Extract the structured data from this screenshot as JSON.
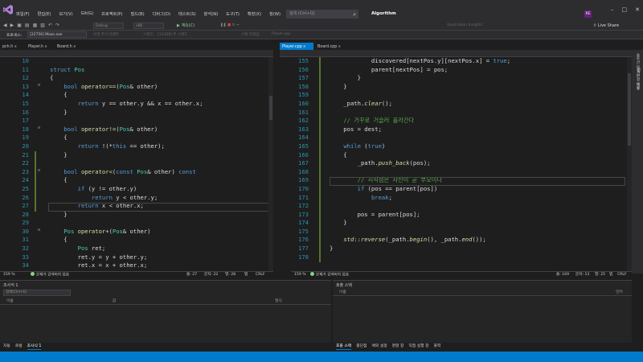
{
  "menu": {
    "items": [
      "파일(F)",
      "편집(E)",
      "보기(V)",
      "Git(G)",
      "프로젝트(P)",
      "빌드(B)",
      "디버그(D)",
      "테스트(S)",
      "분석(N)",
      "도구(T)",
      "확장(X)",
      "창(W)",
      "도움말(H)"
    ],
    "search_placeholder": "검색 (Ctrl+Q)",
    "solution_name": "Algorithm",
    "user_badge": "RE",
    "live_share": "Live Share"
  },
  "toolbar": {
    "debug_config": "Debug",
    "platform": "x86",
    "run_label": "계속(C)",
    "process_label": "프로세스:",
    "process_value": "[22756] Maze.exe",
    "lifecycle_label": "수명 주기 이벤트",
    "thread_label": "스레드:",
    "thread_value": "[15308] 주 스레드",
    "stack_label": "스택 프레임:",
    "stack_value": "Player.cpp",
    "app_insights": "Application Insights"
  },
  "left_tabs": [
    {
      "label": "pch.h",
      "active": false
    },
    {
      "label": "Player.h",
      "active": false
    },
    {
      "label": "Board.h",
      "active": false
    }
  ],
  "right_tabs": [
    {
      "label": "Player.cpp",
      "active": true
    },
    {
      "label": "Board.cpp",
      "active": false
    }
  ],
  "right_rail": [
    "솔루션 탐색기",
    "Git 변경 내용",
    "속성"
  ],
  "left_editor": {
    "lines": [
      {
        "n": "10",
        "tokens": []
      },
      {
        "n": "11",
        "tokens": [
          [
            "kw",
            "struct"
          ],
          [
            "",
            " "
          ],
          [
            "ty",
            "Pos"
          ]
        ]
      },
      {
        "n": "12",
        "tokens": [
          [
            "",
            "{"
          ]
        ]
      },
      {
        "n": "13",
        "tokens": [
          [
            "",
            "    "
          ],
          [
            "kw",
            "bool"
          ],
          [
            "",
            " "
          ],
          [
            "fn",
            "operator=="
          ],
          [
            "",
            "("
          ],
          [
            "ty",
            "Pos"
          ],
          [
            "",
            "& other)"
          ]
        ]
      },
      {
        "n": "14",
        "tokens": [
          [
            "",
            "    {"
          ]
        ]
      },
      {
        "n": "15",
        "tokens": [
          [
            "",
            "        "
          ],
          [
            "kw",
            "return"
          ],
          [
            "",
            " y == other.y && x == other.x;"
          ]
        ]
      },
      {
        "n": "16",
        "tokens": [
          [
            "",
            "    }"
          ]
        ]
      },
      {
        "n": "17",
        "tokens": []
      },
      {
        "n": "18",
        "tokens": [
          [
            "",
            "    "
          ],
          [
            "kw",
            "bool"
          ],
          [
            "",
            " "
          ],
          [
            "fn",
            "operator!="
          ],
          [
            "",
            "("
          ],
          [
            "ty",
            "Pos"
          ],
          [
            "",
            "& other)"
          ]
        ]
      },
      {
        "n": "19",
        "tokens": [
          [
            "",
            "    {"
          ]
        ]
      },
      {
        "n": "20",
        "tokens": [
          [
            "",
            "        "
          ],
          [
            "kw",
            "return"
          ],
          [
            "",
            " !(*"
          ],
          [
            "kw",
            "this"
          ],
          [
            "",
            " == other);"
          ]
        ]
      },
      {
        "n": "21",
        "tokens": [
          [
            "",
            "    }"
          ]
        ]
      },
      {
        "n": "22",
        "tokens": []
      },
      {
        "n": "23",
        "tokens": [
          [
            "",
            "    "
          ],
          [
            "kw",
            "bool"
          ],
          [
            "",
            " "
          ],
          [
            "fn",
            "operator<"
          ],
          [
            "",
            "("
          ],
          [
            "kw",
            "const"
          ],
          [
            "",
            " "
          ],
          [
            "ty",
            "Pos"
          ],
          [
            "",
            "& other) "
          ],
          [
            "kw",
            "const"
          ]
        ]
      },
      {
        "n": "24",
        "tokens": [
          [
            "",
            "    {"
          ]
        ]
      },
      {
        "n": "25",
        "tokens": [
          [
            "",
            "        "
          ],
          [
            "kw",
            "if"
          ],
          [
            "",
            " (y != other.y)"
          ]
        ]
      },
      {
        "n": "26",
        "tokens": [
          [
            "",
            "            "
          ],
          [
            "kw",
            "return"
          ],
          [
            "",
            " y < other.y;"
          ]
        ]
      },
      {
        "n": "27",
        "tokens": [
          [
            "",
            "        "
          ],
          [
            "kw",
            "return"
          ],
          [
            "",
            " x < other.x;"
          ]
        ]
      },
      {
        "n": "28",
        "tokens": [
          [
            "",
            "    }"
          ]
        ]
      },
      {
        "n": "29",
        "tokens": []
      },
      {
        "n": "30",
        "tokens": [
          [
            "",
            "    "
          ],
          [
            "ty",
            "Pos"
          ],
          [
            "",
            " "
          ],
          [
            "fn",
            "operator+"
          ],
          [
            "",
            "("
          ],
          [
            "ty",
            "Pos"
          ],
          [
            "",
            "& other)"
          ]
        ]
      },
      {
        "n": "31",
        "tokens": [
          [
            "",
            "    {"
          ]
        ]
      },
      {
        "n": "32",
        "tokens": [
          [
            "",
            "        "
          ],
          [
            "ty",
            "Pos"
          ],
          [
            "",
            " ret;"
          ]
        ]
      },
      {
        "n": "33",
        "tokens": [
          [
            "",
            "        ret.y = y + other.y;"
          ]
        ]
      },
      {
        "n": "34",
        "tokens": [
          [
            "",
            "        ret.x = x + other.x;"
          ]
        ]
      }
    ]
  },
  "right_editor": {
    "lines": [
      {
        "n": "155",
        "tokens": [
          [
            "",
            "            discovered[nextPos.y][nextPos.x] = "
          ],
          [
            "kw",
            "true"
          ],
          [
            "",
            ";"
          ]
        ]
      },
      {
        "n": "156",
        "tokens": [
          [
            "",
            "            parent[nextPos] = pos;"
          ]
        ]
      },
      {
        "n": "157",
        "tokens": [
          [
            "",
            "        }"
          ]
        ]
      },
      {
        "n": "158",
        "tokens": [
          [
            "",
            "    }"
          ]
        ]
      },
      {
        "n": "159",
        "tokens": []
      },
      {
        "n": "160",
        "tokens": [
          [
            "",
            "    _path."
          ],
          [
            "it",
            "clear"
          ],
          [
            "",
            "();"
          ]
        ]
      },
      {
        "n": "161",
        "tokens": []
      },
      {
        "n": "162",
        "tokens": [
          [
            "",
            "    "
          ],
          [
            "cmt",
            "// 거꾸로 거슬러 올라간다"
          ]
        ]
      },
      {
        "n": "163",
        "tokens": [
          [
            "",
            "    pos = dest;"
          ]
        ]
      },
      {
        "n": "164",
        "tokens": []
      },
      {
        "n": "165",
        "tokens": [
          [
            "",
            "    "
          ],
          [
            "kw",
            "while"
          ],
          [
            "",
            " ("
          ],
          [
            "kw",
            "true"
          ],
          [
            "",
            ")"
          ]
        ]
      },
      {
        "n": "166",
        "tokens": [
          [
            "",
            "    {"
          ]
        ]
      },
      {
        "n": "167",
        "tokens": [
          [
            "",
            "        _path."
          ],
          [
            "it",
            "push_back"
          ],
          [
            "",
            "(pos);"
          ]
        ]
      },
      {
        "n": "168",
        "tokens": []
      },
      {
        "n": "169",
        "tokens": [
          [
            "",
            "        "
          ],
          [
            "cmt",
            "// 시작점은 자신이 곧 부모이다"
          ]
        ]
      },
      {
        "n": "170",
        "tokens": [
          [
            "",
            "        "
          ],
          [
            "kw",
            "if"
          ],
          [
            "",
            " (pos == parent[pos])"
          ]
        ]
      },
      {
        "n": "171",
        "tokens": [
          [
            "",
            "            "
          ],
          [
            "kw",
            "break"
          ],
          [
            "",
            ";"
          ]
        ]
      },
      {
        "n": "172",
        "tokens": []
      },
      {
        "n": "173",
        "tokens": [
          [
            "",
            "        pos = parent[pos];"
          ]
        ]
      },
      {
        "n": "174",
        "tokens": [
          [
            "",
            "    }"
          ]
        ]
      },
      {
        "n": "175",
        "tokens": []
      },
      {
        "n": "176",
        "tokens": [
          [
            "",
            "    "
          ],
          [
            "it",
            "std"
          ],
          [
            "",
            "::"
          ],
          [
            "it",
            "reverse"
          ],
          [
            "",
            "(_path."
          ],
          [
            "it",
            "begin"
          ],
          [
            "",
            "(), _path."
          ],
          [
            "it",
            "end"
          ],
          [
            "",
            "());"
          ]
        ]
      },
      {
        "n": "177",
        "tokens": [
          [
            "",
            "}"
          ]
        ]
      },
      {
        "n": "178",
        "tokens": []
      }
    ]
  },
  "left_status": {
    "zoom": "159 %",
    "issues": "문제가 검색되지 않음",
    "line": "줄: 27",
    "char": "문자: 22",
    "col": "열: 28",
    "tab": "탭",
    "eol": "CRLF"
  },
  "right_status": {
    "zoom": "159 %",
    "issues": "문제가 검색되지 않음",
    "line": "줄: 169",
    "char": "문자: 13",
    "col": "열: 25",
    "tab": "탭",
    "eol": "CRLF"
  },
  "bottom_left_panel": {
    "title": "조사식 1",
    "search": "검색(Ctrl+E)",
    "col_name": "이름",
    "col_value": "값",
    "col_type": "형식",
    "tabs": [
      {
        "label": "자동",
        "active": false
      },
      {
        "label": "로컬",
        "active": false
      },
      {
        "label": "조사식 1",
        "active": true
      }
    ]
  },
  "bottom_right_panel": {
    "title": "호출 스택",
    "col_name": "이름",
    "col_lang": "언어",
    "tabs": [
      {
        "label": "호출 스택",
        "active": true
      },
      {
        "label": "중단점",
        "active": false
      },
      {
        "label": "예외 설정",
        "active": false
      },
      {
        "label": "명령 창",
        "active": false
      },
      {
        "label": "직접 실행 창",
        "active": false
      },
      {
        "label": "출력",
        "active": false
      }
    ]
  },
  "colors": {
    "accent": "#007acc",
    "titlebar": "#2d2d30",
    "editor_bg": "#1e1e1e",
    "keyword": "#569cd6",
    "type": "#4ec9b0",
    "comment": "#57a64a"
  }
}
